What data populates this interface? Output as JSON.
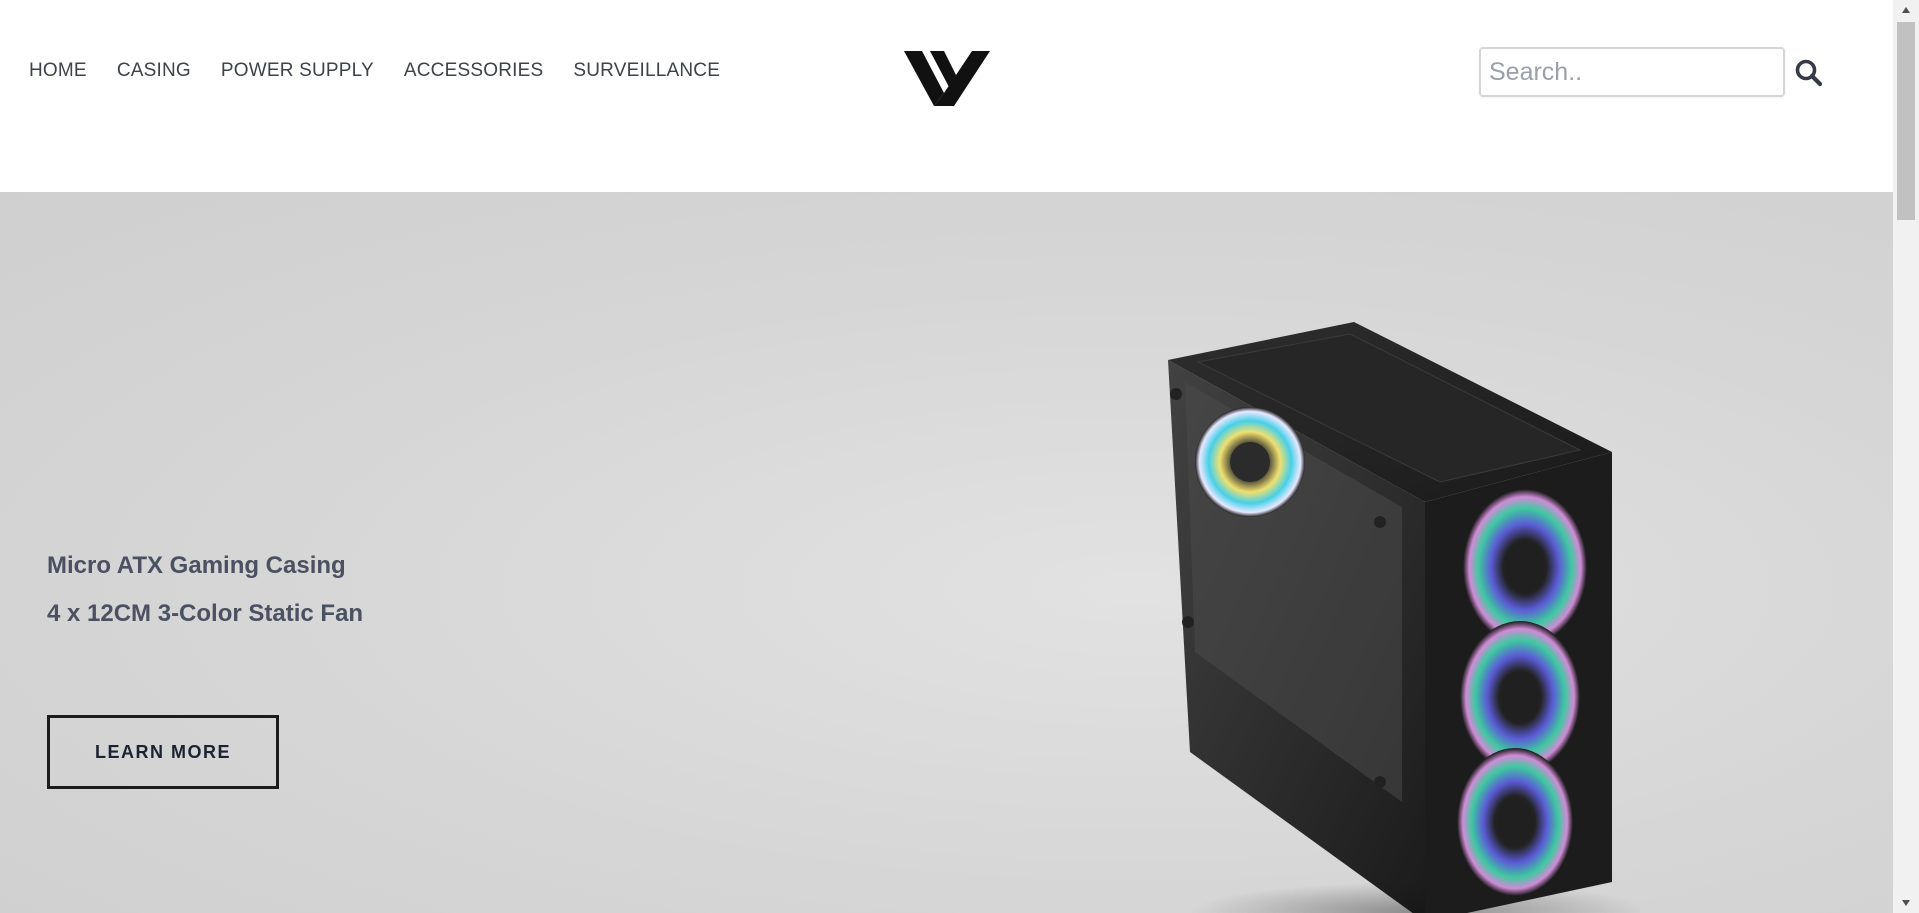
{
  "nav": {
    "items": [
      {
        "label": "HOME"
      },
      {
        "label": "CASING"
      },
      {
        "label": "POWER SUPPLY"
      },
      {
        "label": "ACCESSORIES"
      },
      {
        "label": "SURVEILLANCE"
      }
    ]
  },
  "search": {
    "placeholder": "Search..",
    "value": ""
  },
  "hero": {
    "line1": "Micro ATX Gaming Casing",
    "line2": "4 x 12CM 3-Color Static Fan",
    "button_label": "LEARN MORE"
  },
  "icons": {
    "logo": "brand-v-logo",
    "search": "search-icon"
  },
  "colors": {
    "hero_bg": "#d6d6d6",
    "nav_text": "#3e434a",
    "hero_text": "#4b5160"
  }
}
